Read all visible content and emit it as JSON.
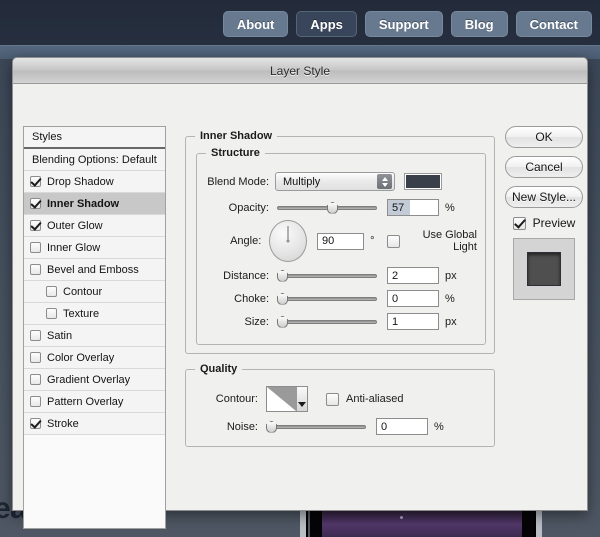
{
  "background": {
    "nav_buttons": [
      {
        "label": "About",
        "active": false
      },
      {
        "label": "Apps",
        "active": true
      },
      {
        "label": "Support",
        "active": false
      },
      {
        "label": "Blog",
        "active": false
      },
      {
        "label": "Contact",
        "active": false
      }
    ],
    "heading_partial": "eatures"
  },
  "dialog": {
    "title": "Layer Style",
    "styles_panel": {
      "header": "Styles",
      "items": [
        {
          "label": "Blending Options: Default",
          "checkbox": false,
          "checked": false,
          "selected": false,
          "indent": false
        },
        {
          "label": "Drop Shadow",
          "checkbox": true,
          "checked": true,
          "selected": false,
          "indent": false
        },
        {
          "label": "Inner Shadow",
          "checkbox": true,
          "checked": true,
          "selected": true,
          "indent": false
        },
        {
          "label": "Outer Glow",
          "checkbox": true,
          "checked": true,
          "selected": false,
          "indent": false
        },
        {
          "label": "Inner Glow",
          "checkbox": true,
          "checked": false,
          "selected": false,
          "indent": false
        },
        {
          "label": "Bevel and Emboss",
          "checkbox": true,
          "checked": false,
          "selected": false,
          "indent": false
        },
        {
          "label": "Contour",
          "checkbox": true,
          "checked": false,
          "selected": false,
          "indent": true
        },
        {
          "label": "Texture",
          "checkbox": true,
          "checked": false,
          "selected": false,
          "indent": true
        },
        {
          "label": "Satin",
          "checkbox": true,
          "checked": false,
          "selected": false,
          "indent": false
        },
        {
          "label": "Color Overlay",
          "checkbox": true,
          "checked": false,
          "selected": false,
          "indent": false
        },
        {
          "label": "Gradient Overlay",
          "checkbox": true,
          "checked": false,
          "selected": false,
          "indent": false
        },
        {
          "label": "Pattern Overlay",
          "checkbox": true,
          "checked": false,
          "selected": false,
          "indent": false
        },
        {
          "label": "Stroke",
          "checkbox": true,
          "checked": true,
          "selected": false,
          "indent": false
        }
      ]
    },
    "inner_shadow": {
      "legend": "Inner Shadow",
      "structure": {
        "legend": "Structure",
        "blend_mode_label": "Blend Mode:",
        "blend_mode_value": "Multiply",
        "shadow_color": "#3a4049",
        "opacity_label": "Opacity:",
        "opacity_value": "57",
        "opacity_unit": "%",
        "angle_label": "Angle:",
        "angle_value": "90",
        "angle_unit": "°",
        "use_global_light_label": "Use Global Light",
        "use_global_light_checked": false,
        "distance_label": "Distance:",
        "distance_value": "2",
        "distance_unit": "px",
        "choke_label": "Choke:",
        "choke_value": "0",
        "choke_unit": "%",
        "size_label": "Size:",
        "size_value": "1",
        "size_unit": "px"
      },
      "quality": {
        "legend": "Quality",
        "contour_label": "Contour:",
        "anti_aliased_label": "Anti-aliased",
        "anti_aliased_checked": false,
        "noise_label": "Noise:",
        "noise_value": "0",
        "noise_unit": "%"
      }
    },
    "buttons": {
      "ok": "OK",
      "cancel": "Cancel",
      "new_style": "New Style...",
      "preview_label": "Preview",
      "preview_checked": true
    }
  }
}
